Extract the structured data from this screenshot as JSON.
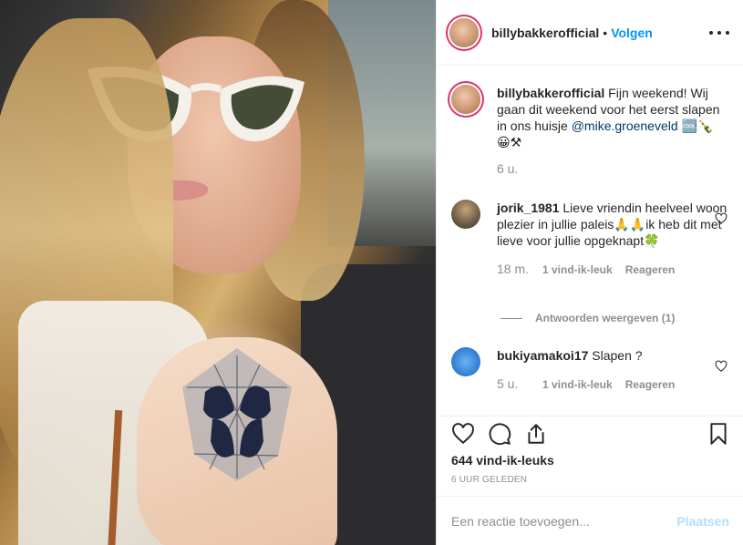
{
  "post": {
    "header": {
      "username": "billybakkerofficial",
      "separator": "•",
      "follow_label": "Volgen"
    },
    "caption": {
      "username": "billybakkerofficial",
      "text_1": "Fijn weekend! Wij gaan dit weekend voor het eerst slapen in ons huisje",
      "mention": "@mike.groeneveld",
      "text_2": "🆒🍾 😀⚒",
      "time": "6 u."
    },
    "comments": [
      {
        "username": "jorik_1981",
        "text": "Lieve vriendin heelveel woon plezier in jullie paleis🙏🙏ik heb dit met lieve voor jullie opgeknapt🍀",
        "time": "18 m.",
        "likes": "1 vind-ik-leuk",
        "reply": "Reageren"
      },
      {
        "username": "bukiyamakoi17",
        "text": "Slapen ?",
        "time": "5 u.",
        "likes": "1 vind-ik-leuk",
        "reply": "Reageren"
      }
    ],
    "view_replies": "Antwoorden weergeven (1)",
    "likes_count": "644 vind-ik-leuks",
    "posted_ago": "6 UUR GELEDEN",
    "composer": {
      "placeholder": "Een reactie toevoegen...",
      "post_label": "Plaatsen"
    },
    "icons": [
      "heart-icon",
      "comment-icon",
      "share-icon",
      "bookmark-icon",
      "more-icon"
    ]
  }
}
